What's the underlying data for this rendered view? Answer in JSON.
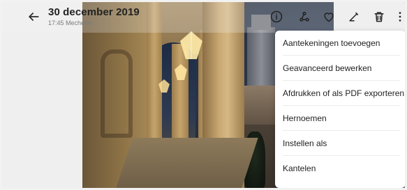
{
  "header": {
    "title": "30 december 2019",
    "subtitle": "17:45 Mechelen"
  },
  "toolbar": {
    "back_icon": "arrow-left-icon",
    "info_icon": "info-icon",
    "share_icon": "share-icon",
    "favorite_icon": "heart-icon",
    "edit_icon": "edit-pencil-icon",
    "delete_icon": "trash-icon",
    "more_icon": "more-vertical-icon"
  },
  "menu": {
    "items": [
      {
        "label": "Aantekeningen toevoegen"
      },
      {
        "label": "Geavanceerd bewerken"
      },
      {
        "label": "Afdrukken of als PDF exporteren"
      },
      {
        "label": "Hernoemen"
      },
      {
        "label": "Instellen als"
      },
      {
        "label": "Kantelen"
      }
    ]
  },
  "colors": {
    "menu_bg": "#ffffff",
    "text_primary": "#1f1f1f",
    "text_secondary": "#7a7a7a",
    "chrome_bg": "#efefef"
  }
}
